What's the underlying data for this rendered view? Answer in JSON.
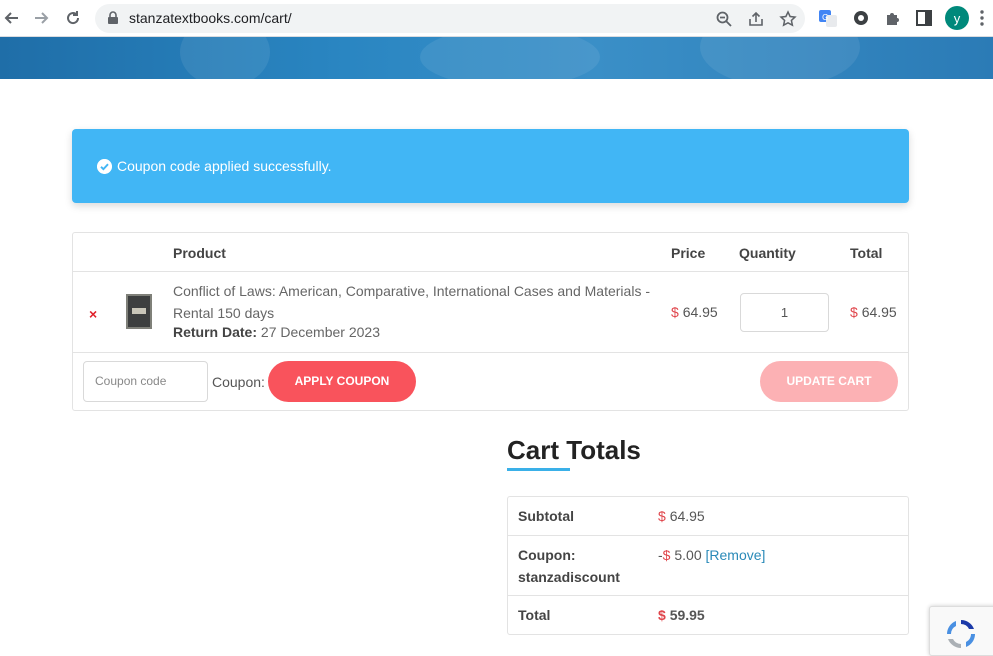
{
  "browser": {
    "url": "stanzatextbooks.com/cart/",
    "avatar_letter": "y",
    "avatar_color": "#00897b"
  },
  "notice": {
    "message": "Coupon code applied successfully.",
    "color": "#41b6f5"
  },
  "cart": {
    "headers": {
      "product": "Product",
      "price": "Price",
      "quantity": "Quantity",
      "total": "Total"
    },
    "item": {
      "remove_symbol": "×",
      "name": "Conflict of Laws: American, Comparative, International Cases and Materials - Rental 150 days",
      "return_label": "Return Date:",
      "return_date": "27 December 2023",
      "currency": "$",
      "price": "64.95",
      "quantity": "1",
      "total": "64.95"
    },
    "coupon_placeholder": "Coupon code",
    "coupon_label": "Coupon:",
    "apply_label": "APPLY COUPON",
    "update_label": "UPDATE CART",
    "accent_color": "#f9535c"
  },
  "totals": {
    "title": "Cart Totals",
    "subtotal_label": "Subtotal",
    "subtotal_currency": "$",
    "subtotal_value": "64.95",
    "coupon_label_line1": "Coupon:",
    "coupon_label_line2": "stanzadiscount",
    "coupon_prefix": "-",
    "coupon_currency": "$",
    "coupon_value": "5.00",
    "coupon_remove": "[Remove]",
    "total_label": "Total",
    "total_currency": "$",
    "total_value": "59.95"
  }
}
